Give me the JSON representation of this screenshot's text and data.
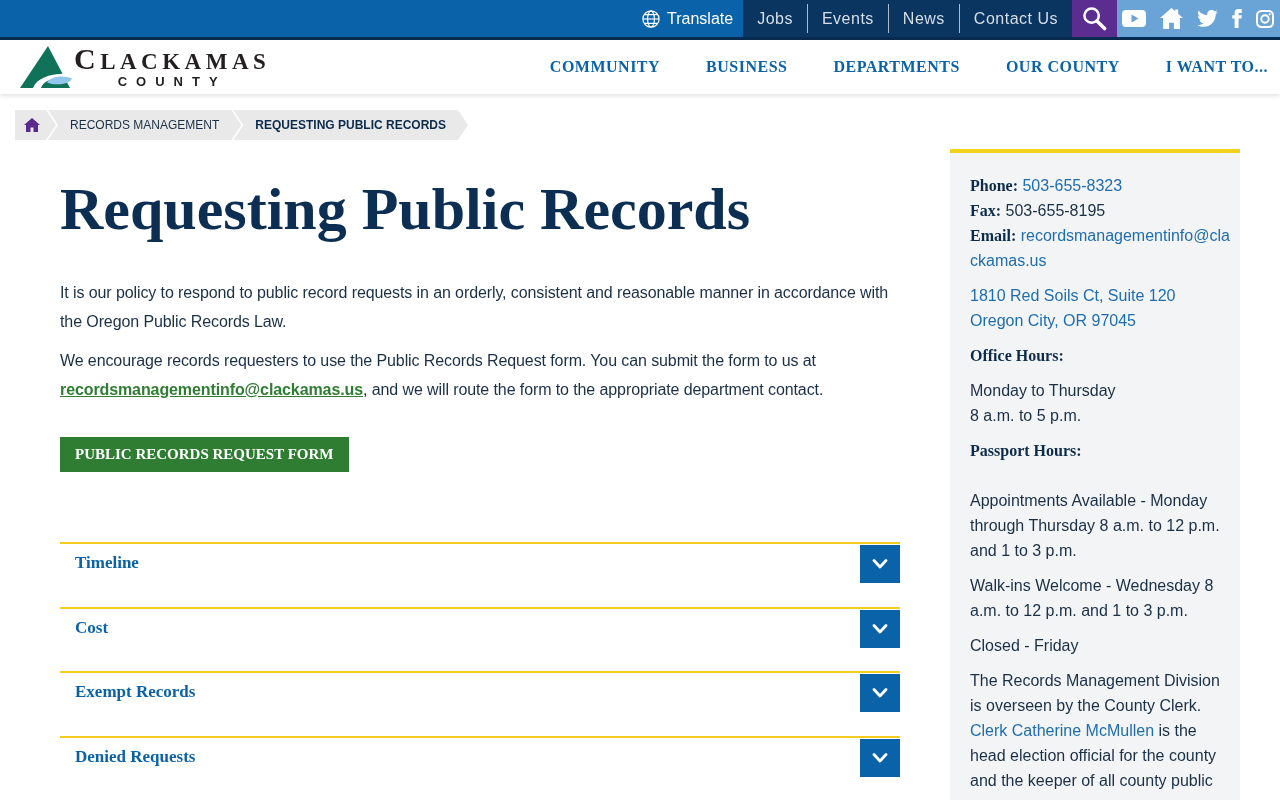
{
  "top_bar": {
    "translate": "Translate",
    "links": [
      "Jobs",
      "Events",
      "News",
      "Contact Us"
    ]
  },
  "header": {
    "logo": {
      "name": "CLACKAMAS",
      "sub": "COUNTY"
    },
    "nav": [
      "COMMUNITY",
      "BUSINESS",
      "DEPARTMENTS",
      "OUR COUNTY",
      "I WANT TO..."
    ]
  },
  "breadcrumb": [
    {
      "label": "RECORDS MANAGEMENT",
      "current": false
    },
    {
      "label": "REQUESTING PUBLIC RECORDS",
      "current": true
    }
  ],
  "main": {
    "title": "Requesting Public Records",
    "paragraphs": [
      {
        "text": "It is our policy to respond to public record requests in an orderly, consistent and reasonable manner in accordance with the Oregon Public Records Law."
      },
      {
        "text": "We encourage records requesters to use the Public Records Request form. You can submit the form to us at ",
        "link": "recordsmanagementinfo@clackamas.us",
        "after": ", and we will route the form to the appropriate department contact."
      }
    ],
    "button": "PUBLIC RECORDS REQUEST FORM",
    "accordion": [
      {
        "title": "Timeline",
        "expanded": false
      },
      {
        "title": "Cost",
        "expanded": false
      },
      {
        "title": "Exempt Records",
        "expanded": false
      },
      {
        "title": "Denied Requests",
        "expanded": false
      }
    ]
  },
  "sidebar": {
    "contacts": [
      {
        "label": "Phone:",
        "value": "503-655-8323",
        "link": true
      },
      {
        "label": "Fax:",
        "value": "503-655-8195",
        "link": false
      },
      {
        "label": "Email:",
        "value": "recordsmanagementinfo@clackamas.us",
        "link": true
      }
    ],
    "address": [
      "1810 Red Soils Ct, Suite 120",
      "Oregon City, OR 97045"
    ],
    "sections": [
      {
        "heading": "Office Hours:",
        "paragraphs": [
          [
            "Monday to Thursday",
            "8 a.m. to 5 p.m."
          ]
        ]
      },
      {
        "heading": "Passport Hours:",
        "paragraphs": [
          [
            "Appointments Available - Monday through Thursday 8 a.m. to 12 p.m. and 1 to 3 p.m."
          ],
          [
            "Walk-ins Welcome - Wednesday 8 a.m. to 12 p.m. and 1 to 3 p.m."
          ],
          [
            "Closed - Friday"
          ]
        ]
      }
    ],
    "note": {
      "text": "The Records Management Division is overseen by the County Clerk. ",
      "link": "Clerk Catherine McMullen",
      "after": " is the head election official for the county and the keeper of all county public"
    }
  }
}
